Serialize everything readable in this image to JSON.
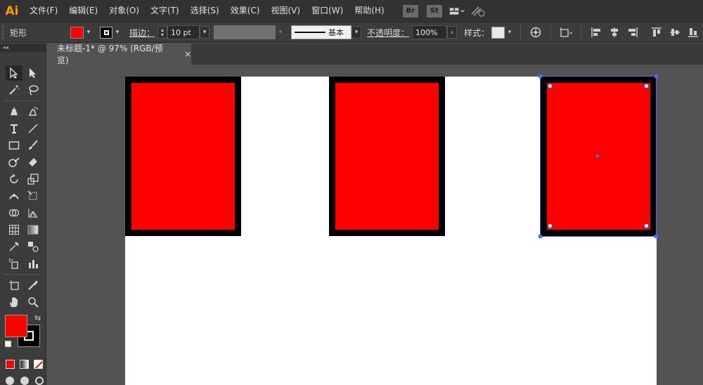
{
  "app": {
    "logo": "Ai"
  },
  "menu": {
    "items": [
      "文件(F)",
      "编辑(E)",
      "对象(O)",
      "文字(T)",
      "选择(S)",
      "效果(C)",
      "视图(V)",
      "窗口(W)",
      "帮助(H)"
    ],
    "bridge_label": "Br",
    "stock_label": "St"
  },
  "control_bar": {
    "object_type": "矩形",
    "stroke_label": "描边：",
    "stroke_value": "10 pt",
    "stroke_profile": "基本",
    "opacity_label": "不透明度：",
    "opacity_value": "100%",
    "style_label": "样式：",
    "colors": {
      "fill": "#ff0000",
      "stroke": "#000000"
    }
  },
  "document": {
    "tab_title": "未标题-1* @ 97% (RGB/预览)",
    "close_glyph": "×"
  },
  "tools": {
    "fill_color": "#ff0000",
    "stroke_color": "#000000",
    "toolpanel_header": "◂◂"
  },
  "artboard": {
    "shapes": [
      {
        "type": "rectangle",
        "fill": "#ff0000",
        "stroke": "#000000",
        "selected": false
      },
      {
        "type": "rectangle",
        "fill": "#ff0000",
        "stroke": "#000000",
        "selected": false
      },
      {
        "type": "rectangle",
        "fill": "#ff0000",
        "stroke": "#000000",
        "selected": true
      }
    ]
  }
}
